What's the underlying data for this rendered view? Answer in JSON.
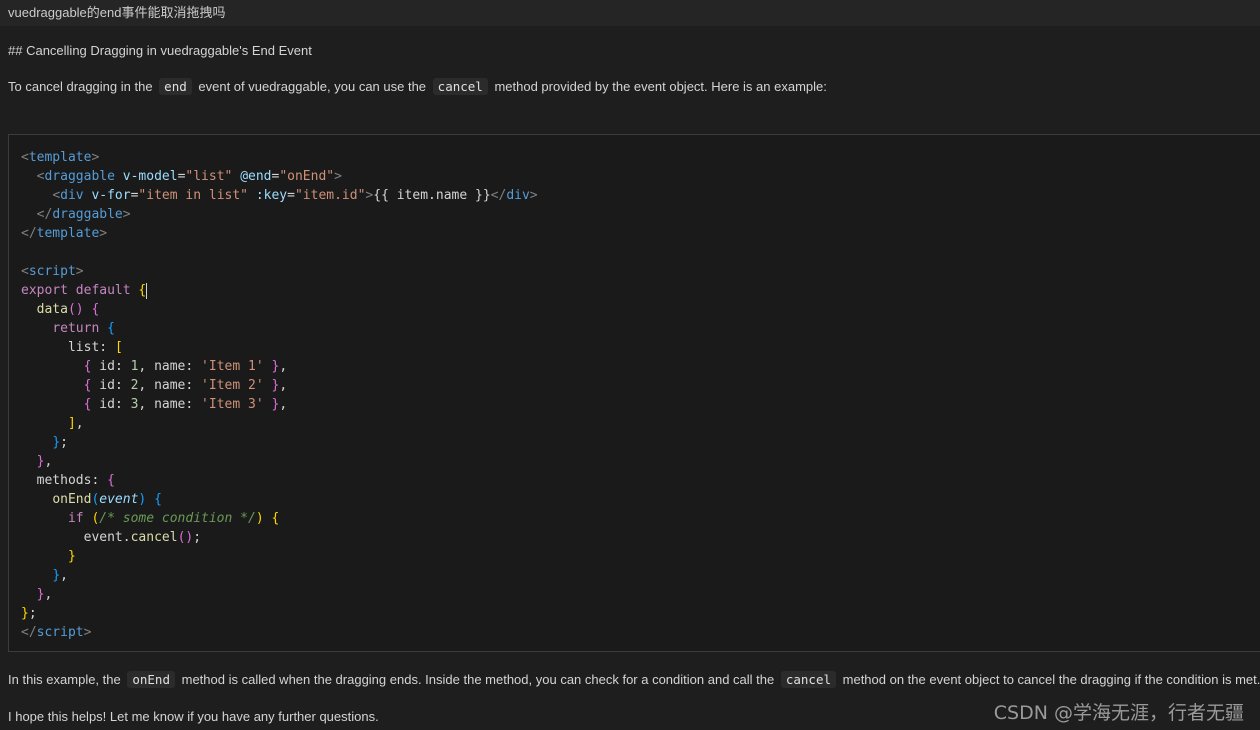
{
  "window": {
    "title": "vuedraggable的end事件能取消拖拽吗"
  },
  "content": {
    "heading": "## Cancelling Dragging in vuedraggable's End Event",
    "intro": {
      "p1": "To cancel dragging in the",
      "c1": "end",
      "p2": "event of vuedraggable, you can use the",
      "c2": "cancel",
      "p3": "method provided by the event object. Here is an example:"
    },
    "code": {
      "template_tag": "template",
      "draggable_tag": "draggable",
      "v_model_attr": "v-model",
      "v_model_val": "\"list\"",
      "end_attr": "@end",
      "end_val": "\"onEnd\"",
      "div_tag": "div",
      "v_for_attr": "v-for",
      "v_for_val": "\"item in list\"",
      "key_attr": ":key",
      "key_val": "\"item.id\"",
      "interp": "{{ item.name }}",
      "script_tag": "script",
      "export_kw": "export",
      "default_kw": "default",
      "data_fn": "data",
      "return_kw": "return",
      "list_prop": "list",
      "items": [
        {
          "id": "1",
          "name": "'Item 1'"
        },
        {
          "id": "2",
          "name": "'Item 2'"
        },
        {
          "id": "3",
          "name": "'Item 3'"
        }
      ],
      "id_key": "id",
      "name_key": "name",
      "methods_prop": "methods",
      "onend_fn": "onEnd",
      "event_param": "event",
      "if_kw": "if",
      "comment": "/* some condition */",
      "event_obj": "event",
      "cancel_fn": "cancel"
    },
    "explanation": {
      "p1": "In this example, the",
      "c1": "onEnd",
      "p2": "method is called when the dragging ends. Inside the method, you can check for a condition and call the",
      "c2": "cancel",
      "p3": "method on the event object to cancel the dragging if the condition is met."
    },
    "closing": "I hope this helps! Let me know if you have any further questions."
  },
  "watermark": "CSDN @学海无涯，行者无疆",
  "colors": {
    "background": "#1e1e1e",
    "titlebar": "#252526",
    "tag": "#569cd6",
    "string": "#ce9178",
    "function": "#dcdcaa",
    "number": "#b5cea8"
  }
}
